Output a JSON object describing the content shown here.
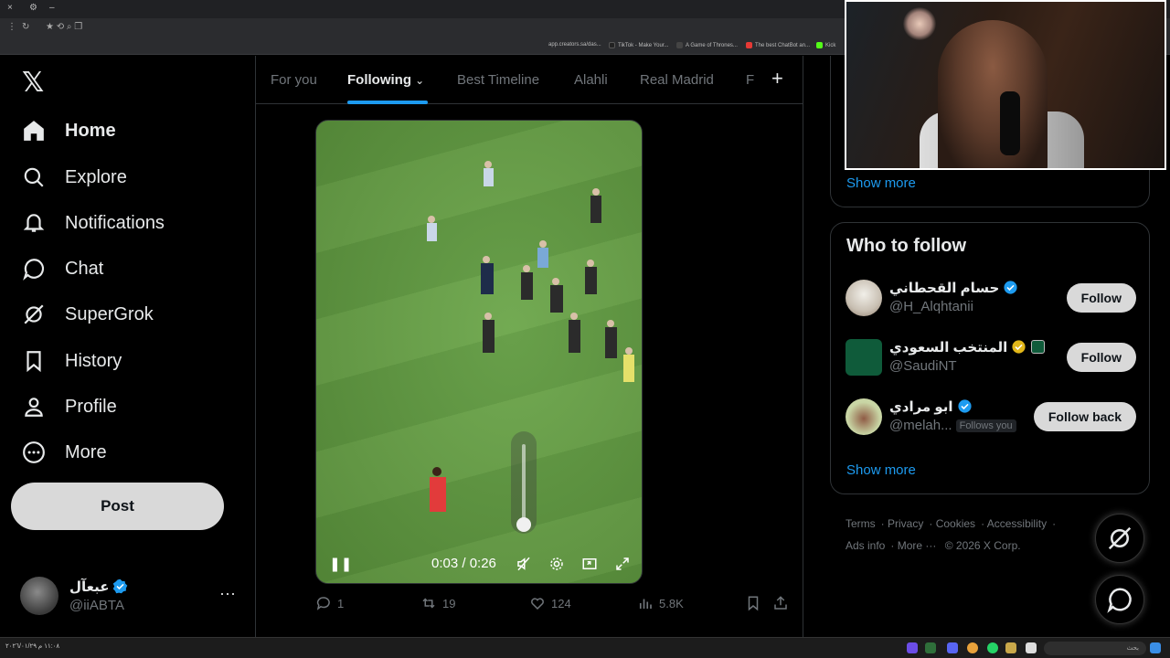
{
  "browser": {
    "window_controls": [
      "×",
      "⚙",
      "–"
    ],
    "bookmarks": [
      {
        "label": "app.creators.sa/das...",
        "color": "#f1f3f4"
      },
      {
        "label": "TikTok - Make Your...",
        "color": "#222222"
      },
      {
        "label": "A Game of Thrones...",
        "color": "#111111"
      },
      {
        "label": "The best ChatBot an...",
        "color": "#e53935"
      },
      {
        "label": "Kick",
        "color": "#53fc18"
      }
    ]
  },
  "sidebar": {
    "logo": "𝕏",
    "items": [
      {
        "label": "Home",
        "icon": "home-icon",
        "active": true
      },
      {
        "label": "Explore",
        "icon": "search-icon"
      },
      {
        "label": "Notifications",
        "icon": "bell-icon"
      },
      {
        "label": "Chat",
        "icon": "chat-icon"
      },
      {
        "label": "SuperGrok",
        "icon": "grok-icon"
      },
      {
        "label": "History",
        "icon": "bookmark-icon"
      },
      {
        "label": "Profile",
        "icon": "person-icon"
      },
      {
        "label": "More",
        "icon": "more-circle-icon"
      }
    ],
    "post_label": "Post",
    "account": {
      "name": "عبعآل",
      "handle": "@iiABTA"
    }
  },
  "timeline": {
    "tabs": [
      {
        "label": "For you"
      },
      {
        "label": "Following",
        "active": true
      },
      {
        "label": "Best Timeline"
      },
      {
        "label": "Alahli"
      },
      {
        "label": "Real Madrid"
      },
      {
        "label": "F"
      }
    ],
    "add_tab": "+",
    "video": {
      "current_time": "0:03",
      "duration": "0:26",
      "time_text": "0:03 / 0:26",
      "volume_level": 0.0
    },
    "actions": {
      "replies": "1",
      "reposts": "19",
      "likes": "124",
      "views": "5.8K"
    }
  },
  "right": {
    "show_more_top": "Show more",
    "who_to_follow": {
      "title": "Who to follow",
      "accounts": [
        {
          "name": "حسام القحطاني",
          "handle": "@H_Alqhtanii",
          "button": "Follow",
          "verified_color": "#1d9bf0",
          "avatar_color": "#d9cfc4"
        },
        {
          "name": "المنتخب السعودي",
          "handle": "@SaudiNT",
          "button": "Follow",
          "verified_color": "#e2b719",
          "avatar_color": "#0f5b3a"
        },
        {
          "name": "ابو مرادي",
          "handle": "@melah...",
          "follows_you": "Follows you",
          "button": "Follow back",
          "verified_color": "#1d9bf0",
          "avatar_color": "#c9d6a5"
        }
      ],
      "show_more": "Show more"
    },
    "footer": [
      "Terms",
      "Privacy",
      "Cookies",
      "Accessibility",
      "Ads info",
      "More ···",
      "© 2026 X Corp."
    ]
  },
  "taskbar": {
    "left_text": "١١:٠٨ م  ٢٠٢٦/٠١/٢٩",
    "search_placeholder": "بحث"
  },
  "colors": {
    "accent": "#1d9bf0",
    "bg": "#000000",
    "muted": "#71767b"
  }
}
